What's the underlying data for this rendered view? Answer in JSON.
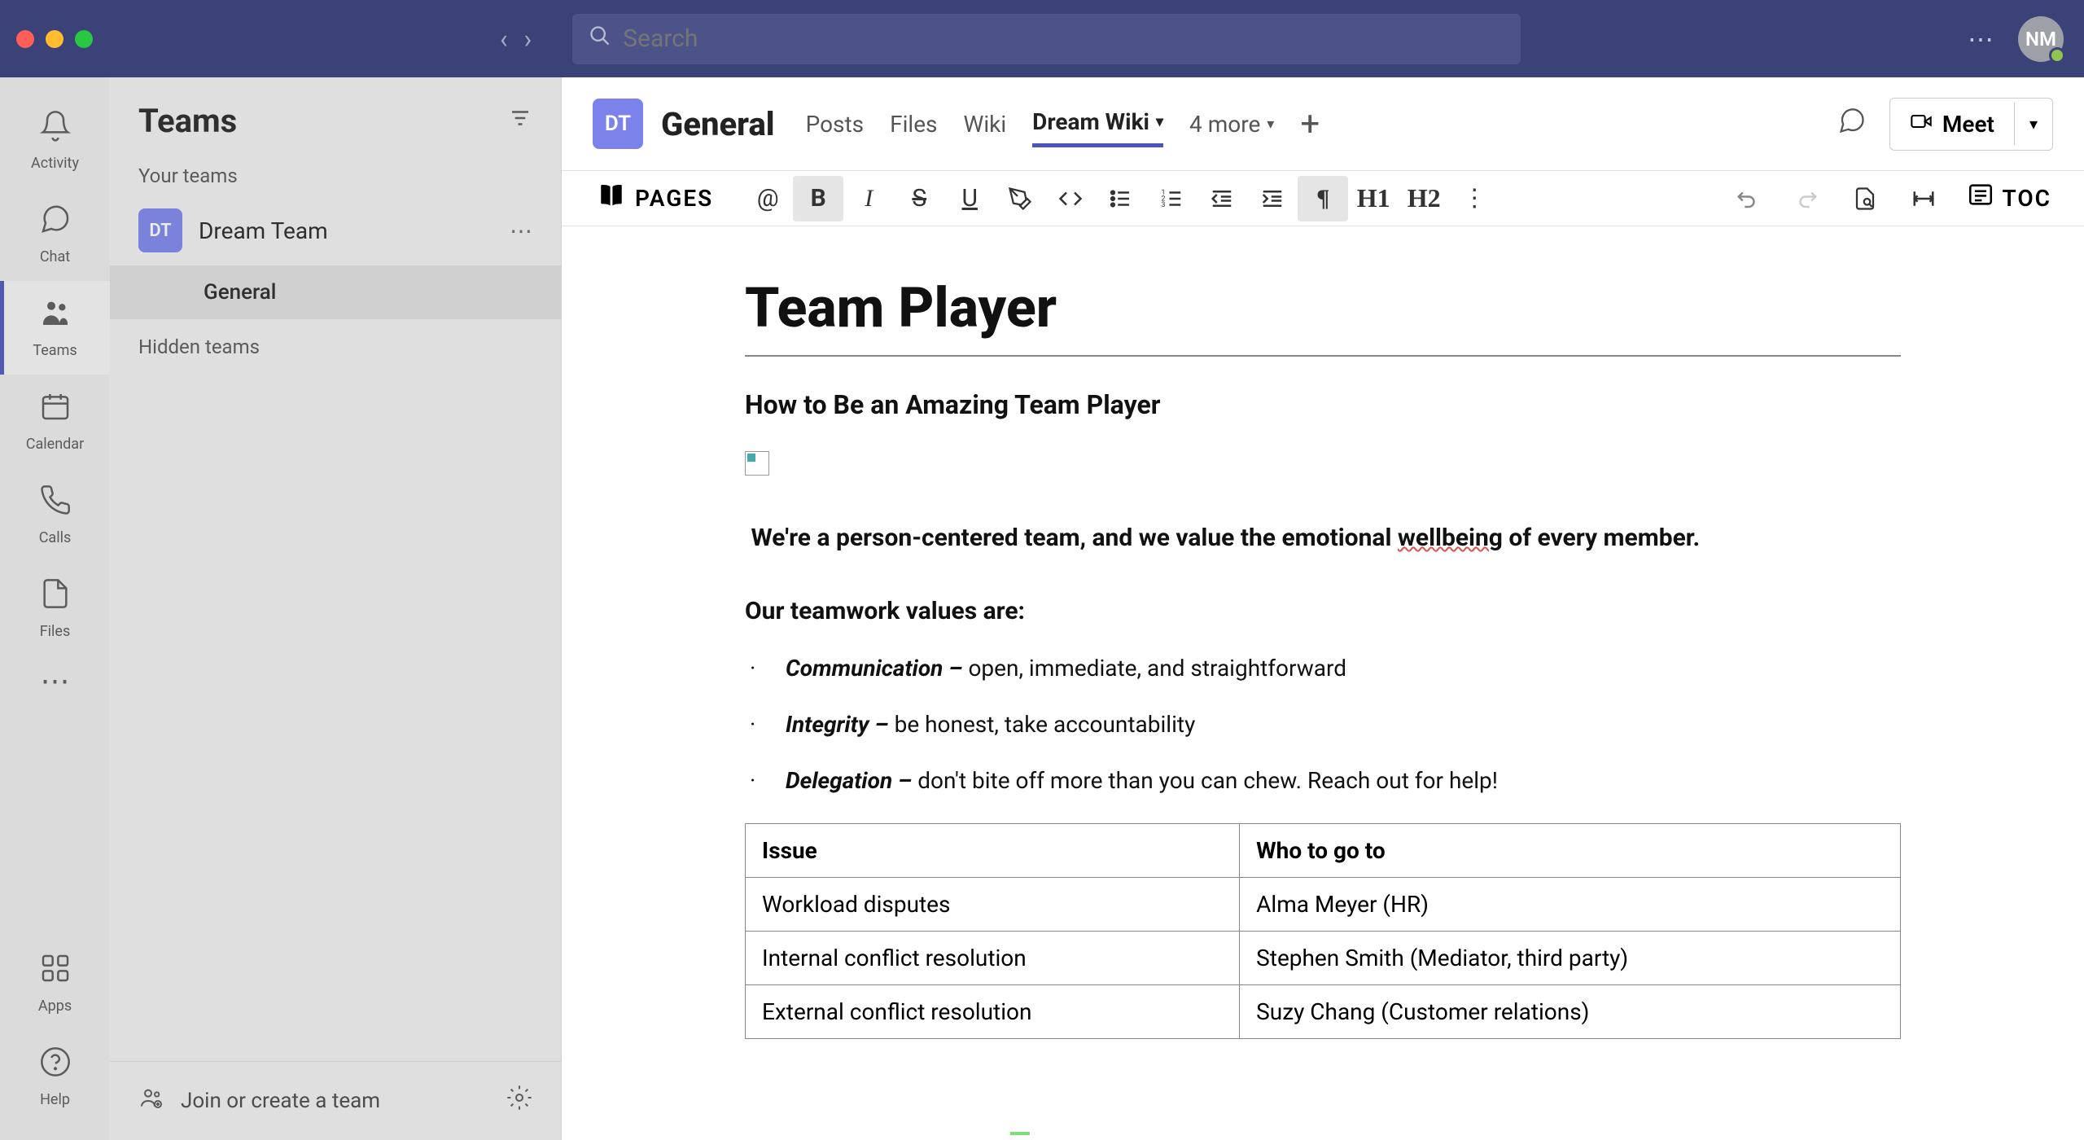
{
  "titlebar": {
    "search_placeholder": "Search",
    "avatar_initials": "NM"
  },
  "rail": {
    "items": [
      {
        "label": "Activity"
      },
      {
        "label": "Chat"
      },
      {
        "label": "Teams"
      },
      {
        "label": "Calendar"
      },
      {
        "label": "Calls"
      },
      {
        "label": "Files"
      }
    ],
    "bottom": [
      {
        "label": "Apps"
      },
      {
        "label": "Help"
      }
    ]
  },
  "sidebar": {
    "title": "Teams",
    "sections": {
      "your_teams": "Your teams",
      "hidden_teams": "Hidden teams"
    },
    "teams": [
      {
        "initials": "DT",
        "name": "Dream Team",
        "channels": [
          {
            "name": "General"
          }
        ]
      }
    ],
    "footer": {
      "join_create": "Join or create a team"
    }
  },
  "channel_header": {
    "avatar": "DT",
    "title": "General",
    "tabs": [
      {
        "label": "Posts"
      },
      {
        "label": "Files"
      },
      {
        "label": "Wiki"
      },
      {
        "label": "Dream Wiki",
        "active": true
      },
      {
        "label": "4 more"
      }
    ],
    "meet": "Meet"
  },
  "toolbar": {
    "pages": "PAGES",
    "toc": "TOC"
  },
  "document": {
    "title": "Team Player",
    "subtitle": "How to Be an Amazing Team Player",
    "intro_before": "We're a person-centered team, and we value the emotional ",
    "intro_wavy": "wellbeing",
    "intro_after": " of every member.",
    "values_heading": "Our teamwork values are:",
    "values": [
      {
        "name": "Communication",
        "dash": " – ",
        "desc": "open, immediate, and straightforward"
      },
      {
        "name": "Integrity",
        "dash": " – ",
        "desc": "be honest, take accountability"
      },
      {
        "name": "Delegation",
        "dash": " – ",
        "desc": "don't bite off more than you can chew. Reach out for help!"
      }
    ],
    "table": {
      "headers": [
        "Issue",
        "Who to go to"
      ],
      "rows": [
        [
          "Workload disputes",
          "Alma Meyer (HR)"
        ],
        [
          "Internal conflict resolution",
          "Stephen Smith (Mediator, third party)"
        ],
        [
          "External conflict resolution",
          "Suzy Chang (Customer relations)"
        ]
      ]
    }
  }
}
